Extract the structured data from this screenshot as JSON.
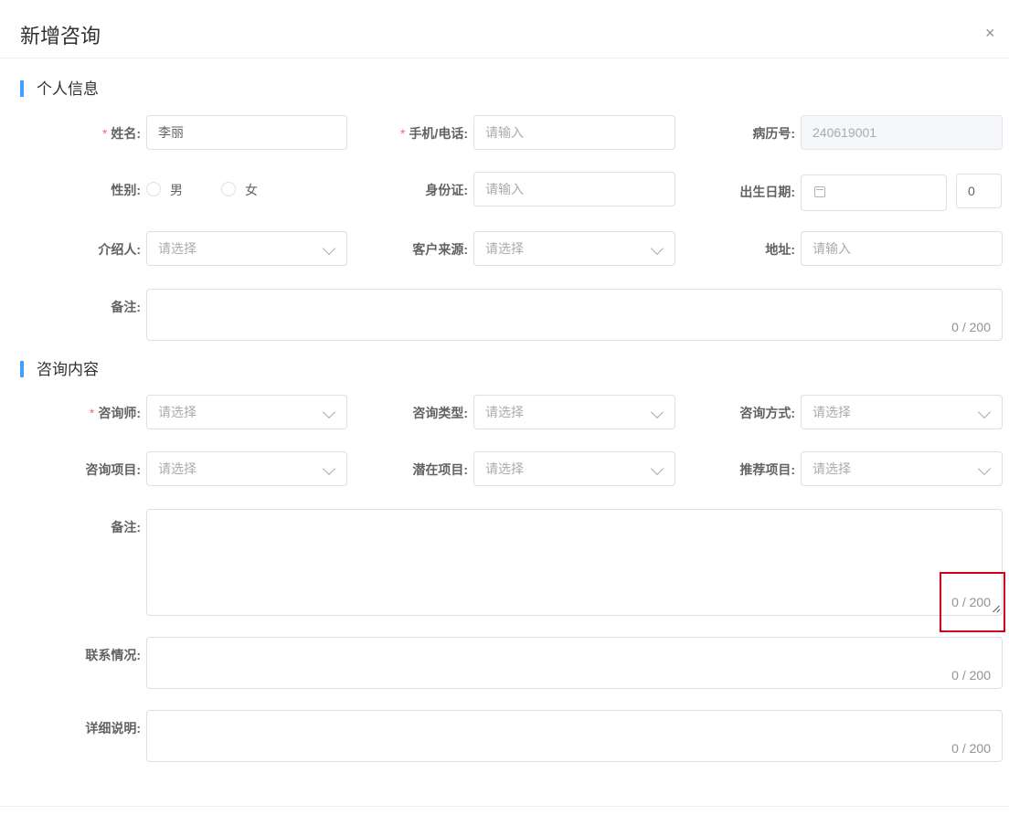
{
  "dialog": {
    "title": "新增咨询",
    "close_icon": "×"
  },
  "sections": {
    "personal": "个人信息",
    "consult": "咨询内容"
  },
  "personal": {
    "name_label": "姓名:",
    "name_value": "李丽",
    "phone_label": "手机/电话:",
    "phone_placeholder": "请输入",
    "record_label": "病历号:",
    "record_value": "240619001",
    "gender_label": "性别:",
    "gender_male": "男",
    "gender_female": "女",
    "idcard_label": "身份证:",
    "idcard_placeholder": "请输入",
    "birth_label": "出生日期:",
    "birth_placeholder": "",
    "age_value": "0",
    "referrer_label": "介绍人:",
    "referrer_placeholder": "请选择",
    "source_label": "客户来源:",
    "source_placeholder": "请选择",
    "address_label": "地址:",
    "address_placeholder": "请输入",
    "remark_label": "备注:",
    "remark_count": "0 / 200"
  },
  "consult": {
    "consultant_label": "咨询师:",
    "consultant_placeholder": "请选择",
    "type_label": "咨询类型:",
    "type_placeholder": "请选择",
    "method_label": "咨询方式:",
    "method_placeholder": "请选择",
    "project_label": "咨询项目:",
    "project_placeholder": "请选择",
    "potential_label": "潜在项目:",
    "potential_placeholder": "请选择",
    "recommend_label": "推荐项目:",
    "recommend_placeholder": "请选择",
    "remark_label": "备注:",
    "remark_count": "0 / 200",
    "contact_label": "联系情况:",
    "contact_count": "0 / 200",
    "detail_label": "详细说明:",
    "detail_count": "0 / 200"
  },
  "colors": {
    "accent": "#409eff",
    "required": "#f56c6c",
    "highlight": "#d0021b"
  }
}
